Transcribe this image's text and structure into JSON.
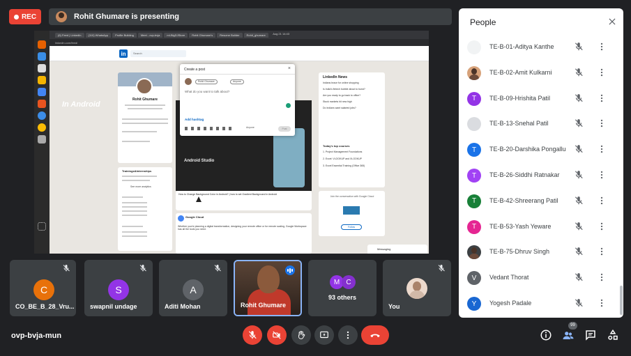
{
  "recording": {
    "label": "REC",
    "color": "#ea4335"
  },
  "presenting": {
    "text": "Rohit Ghumare is presenting"
  },
  "shared_screen": {
    "browser_tabs": [
      "(6) Feed | LinkedIn",
      "(110) WhatsApp",
      "Profile Building",
      "Meet - ovp-bvja",
      "ml-BigDJStore",
      "Rohit Ghumare's",
      "Resume Builder",
      "Rohit_ghumare"
    ],
    "address": "linkedin.com/feed/",
    "os_time": "Aug 21  14:43",
    "search_placeholder": "Search",
    "profile_name": "Rohit Ghumare",
    "left_card_title": "Trainings&Internships",
    "left_card_link": "See more analytics",
    "video_title": "In Android",
    "video_sub": "Android Studio",
    "caption": "How to Change Background Color in Android? | how to set Gradient Background in Android",
    "post2_title": "Google Cloud",
    "post2_text": "Whether you're planning a digital transformation, designing your remote office or for remote scaling, Google Workspace has all the tools you need.",
    "news_title": "LinkedIn News",
    "news_items": [
      "Indians brace for online shopping",
      "Is India's fintech bubble about to burst?",
      "Are you ready to go back to office?",
      "Stock markets hit new high",
      "Do Indians want salaried jobs?"
    ],
    "courses_title": "Today's top courses",
    "courses": [
      "1. Project Management Foundations",
      "2. Excel: VLOOKUP and XLOOKUP",
      "3. Excel Essential Training (Office 365)"
    ],
    "ad_text": "Join the conversation with Google Cloud",
    "follow_label": "Follow",
    "messaging_label": "Messaging",
    "modal": {
      "title": "Create a post",
      "author": "Rohit Ghumare",
      "visibility": "Anyone",
      "prompt": "What do you want to talk about?",
      "hashtag": "Add hashtag",
      "anyone": "Anyone",
      "post": "Post"
    }
  },
  "tiles": [
    {
      "name": "CO_BE_B_28_Vru...",
      "initial": "C",
      "color": "#e8710a",
      "muted": true
    },
    {
      "name": "swapnil undage",
      "initial": "S",
      "color": "#9334e6",
      "muted": true
    },
    {
      "name": "Aditi Mohan",
      "initial": "A",
      "color": "#5f6368",
      "muted": true
    },
    {
      "name": "Rohit Ghumare",
      "speaking": true
    },
    {
      "name": "93 others",
      "initials": [
        "M",
        "C"
      ],
      "colors": [
        "#9334e6",
        "#8430ce"
      ]
    },
    {
      "name": "You",
      "muted": true
    }
  ],
  "meeting_code": "ovp-bvja-mun",
  "participants_count": "99",
  "people_panel": {
    "title": "People",
    "participants": [
      {
        "name": "TE-B-01-Aditya Kanthe",
        "initial": "",
        "color": "#f1f3f4"
      },
      {
        "name": "TE-B-02-Amit Kulkarni",
        "initial": "",
        "color": "#d7a27a",
        "photo": true
      },
      {
        "name": "TE-B-09-Hrishita Patil",
        "initial": "T",
        "color": "#9334e6"
      },
      {
        "name": "TE-B-13-Snehal Patil",
        "initial": "",
        "color": "#dadce0"
      },
      {
        "name": "TE-B-20-Darshika Pongallu",
        "initial": "T",
        "color": "#1a73e8"
      },
      {
        "name": "TE-B-26-Siddhi Ratnakar",
        "initial": "T",
        "color": "#a142f4"
      },
      {
        "name": "TE-B-42-Shreerang Patil",
        "initial": "T",
        "color": "#188038"
      },
      {
        "name": "TE-B-53-Yash Yeware",
        "initial": "T",
        "color": "#e52592"
      },
      {
        "name": "TE-B-75-Dhruv Singh",
        "initial": "",
        "color": "#3c4043",
        "photo": true
      },
      {
        "name": "Vedant Thorat",
        "initial": "V",
        "color": "#5f6368"
      },
      {
        "name": "Yogesh Padale",
        "initial": "Y",
        "color": "#1967d2"
      }
    ]
  }
}
